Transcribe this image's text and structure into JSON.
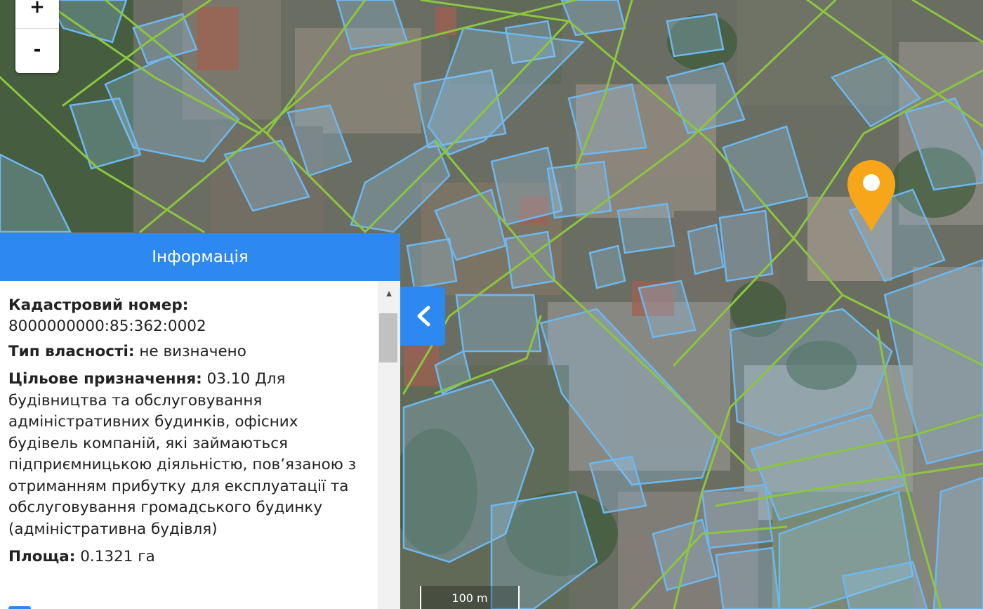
{
  "map": {
    "zoom_in_label": "+",
    "zoom_out_label": "-",
    "scale_label": "100 m",
    "colors": {
      "parcel_outline": "#6cb8f0",
      "parcel_fill": "rgba(150,200,240,0.28)",
      "street_line": "#8cc63f",
      "marker": "#f7a61a"
    },
    "marker_icon": "map-marker-icon"
  },
  "info_panel": {
    "title": "Інформація",
    "cadastral_number_label": "Кадастровий номер:",
    "cadastral_number_value": "8000000000:85:362:0002",
    "ownership_label": "Тип власності:",
    "ownership_value": "не визначено",
    "purpose_label": "Цільове призначення:",
    "purpose_value": "03.10 Для будівництва та обслуговування адміністративних будинків, офісних будівель компаній, які займаються підприємницькою діяльністю, пов’язаною з отриманням прибутку для експлуатації та обслуговування громадського будинку (адміністративна будівля)",
    "area_label": "Площа:",
    "area_value": "0.1321 га",
    "collapse_icon": "chevron-left-icon",
    "scroll_up_icon": "caret-up-icon"
  }
}
